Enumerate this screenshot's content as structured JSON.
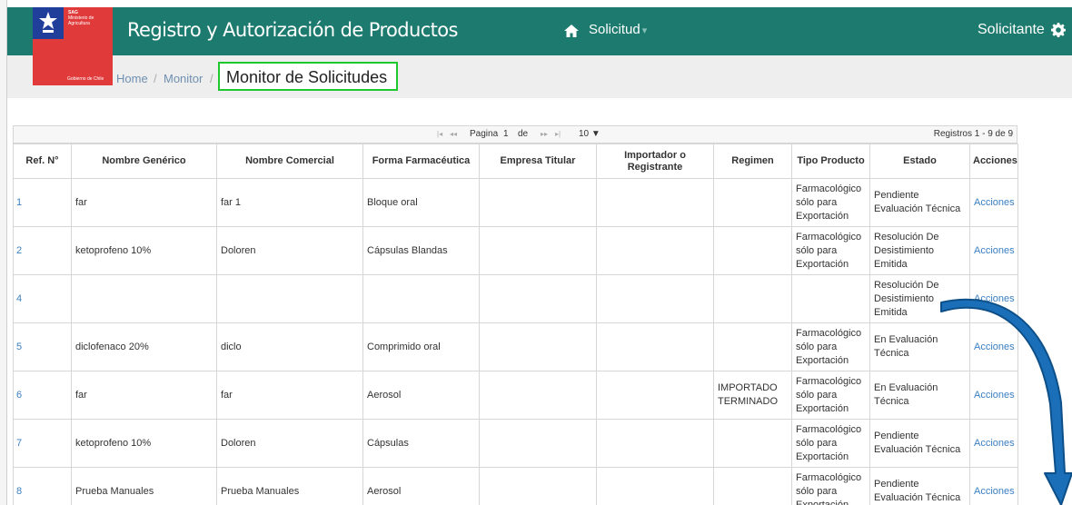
{
  "logo": {
    "agency": "SAG",
    "ministry": "Ministerio de Agricultura",
    "government": "Gobierno de Chile"
  },
  "header": {
    "title": "Registro y Autorización de Productos",
    "nav_solicitud": "Solicitud",
    "user": "Solicitante"
  },
  "breadcrumb": {
    "home": "Home",
    "monitor": "Monitor",
    "current": "Monitor de Solicitudes",
    "sep": "/"
  },
  "pager": {
    "label": "Pagina",
    "page": "1",
    "de": "de",
    "total": "",
    "page_size": "10 ▼",
    "records": "Registros 1 - 9 de 9"
  },
  "columns": [
    "Ref. N°",
    "Nombre Genérico",
    "Nombre Comercial",
    "Forma Farmacéutica",
    "Empresa Titular",
    "Importador o Registrante",
    "Regimen",
    "Tipo Producto",
    "Estado",
    "Acciones"
  ],
  "rows": [
    {
      "ref": "1",
      "generico": "far",
      "comercial": "far 1",
      "forma": "Bloque oral",
      "empresa": "",
      "importador": "",
      "regimen": "",
      "tipo": "Farmacológico sólo para Exportación",
      "estado": "Pendiente Evaluación Técnica",
      "acciones": "Acciones"
    },
    {
      "ref": "2",
      "generico": "ketoprofeno 10%",
      "comercial": "Doloren",
      "forma": "Cápsulas Blandas",
      "empresa": "",
      "importador": "",
      "regimen": "",
      "tipo": "Farmacológico sólo para Exportación",
      "estado": "Resolución De Desistimiento Emitida",
      "acciones": "Acciones"
    },
    {
      "ref": "4",
      "generico": "",
      "comercial": "",
      "forma": "",
      "empresa": "",
      "importador": "",
      "regimen": "",
      "tipo": "",
      "estado": "Resolución De Desistimiento Emitida",
      "acciones": "Acciones"
    },
    {
      "ref": "5",
      "generico": "diclofenaco 20%",
      "comercial": "diclo",
      "forma": "Comprimido oral",
      "empresa": "",
      "importador": "",
      "regimen": "",
      "tipo": "Farmacológico sólo para Exportación",
      "estado": "En Evaluación Técnica",
      "acciones": "Acciones"
    },
    {
      "ref": "6",
      "generico": "far",
      "comercial": "far",
      "forma": "Aerosol",
      "empresa": "",
      "importador": "",
      "regimen": "IMPORTADO TERMINADO",
      "tipo": "Farmacológico sólo para Exportación",
      "estado": "En Evaluación Técnica",
      "acciones": "Acciones"
    },
    {
      "ref": "7",
      "generico": "ketoprofeno 10%",
      "comercial": "Doloren",
      "forma": "Cápsulas",
      "empresa": "",
      "importador": "",
      "regimen": "",
      "tipo": "Farmacológico sólo para Exportación",
      "estado": "Pendiente Evaluación Técnica",
      "acciones": "Acciones"
    },
    {
      "ref": "8",
      "generico": "Prueba Manuales",
      "comercial": "Prueba Manuales",
      "forma": "Aerosol",
      "empresa": "",
      "importador": "",
      "regimen": "",
      "tipo": "Farmacológico sólo para Exportación",
      "estado": "Pendiente Evaluación Técnica",
      "acciones": "Acciones"
    }
  ],
  "colors": {
    "header_bg": "#1d7a6e",
    "link": "#3a7fc1",
    "highlight": "#20c830",
    "arrow": "#1b6fb8"
  }
}
